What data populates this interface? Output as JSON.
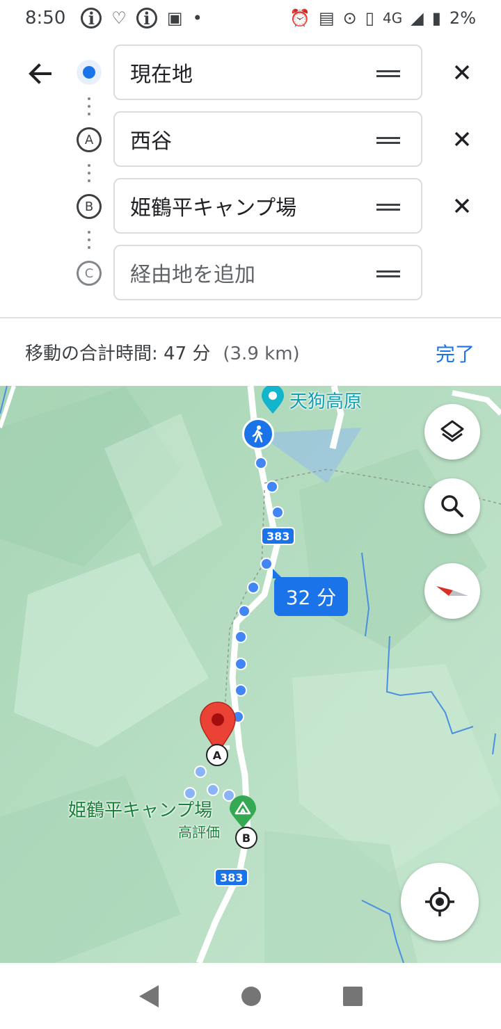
{
  "status_bar": {
    "time": "8:50",
    "network": "4G",
    "battery": "2%"
  },
  "route": {
    "waypoints": [
      {
        "marker": "current-location",
        "value": "現在地",
        "removable": true
      },
      {
        "marker": "A",
        "value": "西谷",
        "removable": true
      },
      {
        "marker": "B",
        "value": "姫鶴平キャンプ場",
        "removable": true
      },
      {
        "marker": "C",
        "placeholder": "経由地を追加",
        "removable": false
      }
    ]
  },
  "summary": {
    "total_time": "移動の合計時間: 47 分",
    "distance": "(3.9 km)",
    "done_label": "完了"
  },
  "map": {
    "place_label_top": "天狗高原",
    "place_label_camp": "姫鶴平キャンプ場",
    "camp_rating": "高評価",
    "road_number": "383",
    "road_number_2": "383",
    "segment_time": "32 分",
    "marker_a": "A",
    "marker_b": "B",
    "colors": {
      "route_blue": "#4285f4",
      "map_green": "#b7dcc2",
      "pin_red": "#ea4335",
      "camp_green": "#34a853"
    }
  },
  "icons": {
    "layers": "layers-icon",
    "search": "search-icon",
    "compass": "compass-icon",
    "my_location": "my-location-icon",
    "walking": "walking-person-icon"
  }
}
